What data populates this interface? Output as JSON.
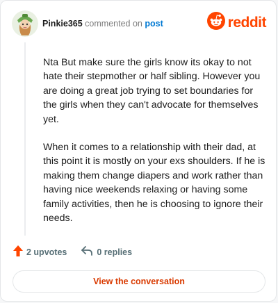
{
  "comment": {
    "username": "Pinkie365",
    "action_text": "commented on",
    "post_link": "post",
    "paragraphs": [
      "Nta But make sure the girls know its okay to not hate their stepmother or half sibling. However you are doing a great job trying to set boundaries for the girls when they can't advocate for themselves yet.",
      "When it comes to a relationship with their dad, at this point it is mostly on your exs shoulders. If he is making them change diapers and work rather than having nice weekends relaxing or having some family activities, then he is choosing to ignore their needs."
    ],
    "upvotes_label": "2 upvotes",
    "replies_label": "0 replies"
  },
  "brand": {
    "name": "reddit",
    "color": "#ff4500"
  },
  "cta": {
    "label": "View the conversation"
  },
  "icons": {
    "avatar": "user-avatar-icon",
    "logo": "reddit-logo-icon",
    "upvote": "upvote-arrow-icon",
    "reply": "reply-arrow-icon"
  }
}
